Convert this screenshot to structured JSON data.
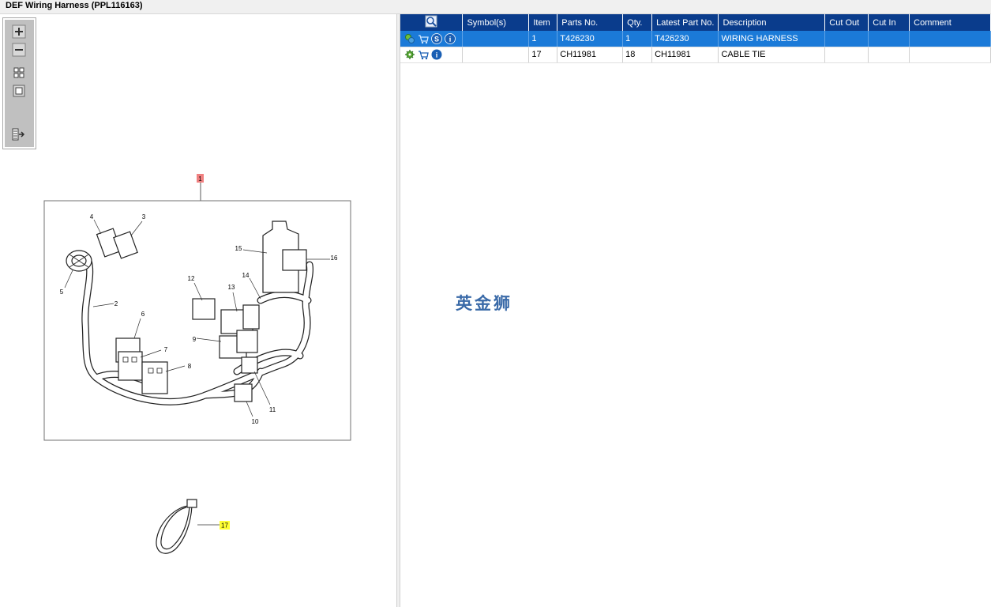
{
  "window": {
    "title": "DEF Wiring Harness (PPL116163)"
  },
  "drawing": {
    "callouts": [
      "1",
      "2",
      "3",
      "4",
      "5",
      "6",
      "7",
      "8",
      "9",
      "10",
      "11",
      "12",
      "13",
      "14",
      "15",
      "16",
      "17"
    ]
  },
  "table": {
    "headers": [
      "",
      "Symbol(s)",
      "Item",
      "Parts No.",
      "Qty.",
      "Latest Part No.",
      "Description",
      "Cut Out",
      "Cut In",
      "Comment"
    ],
    "rows": [
      {
        "symbols": "",
        "item": "1",
        "part_no": "T426230",
        "qty": "1",
        "latest_part_no": "T426230",
        "description": "WIRING HARNESS",
        "cut_out": "",
        "cut_in": "",
        "comment": ""
      },
      {
        "symbols": "",
        "item": "17",
        "part_no": "CH11981",
        "qty": "18",
        "latest_part_no": "CH11981",
        "description": "CABLE TIE",
        "cut_out": "",
        "cut_in": "",
        "comment": ""
      }
    ]
  },
  "watermark": "英金狮",
  "colors": {
    "header_bg": "#0a3c8c",
    "selected_row": "#1b7ad8",
    "callout_red": "#f08080",
    "callout_yellow": "#ffff33"
  }
}
